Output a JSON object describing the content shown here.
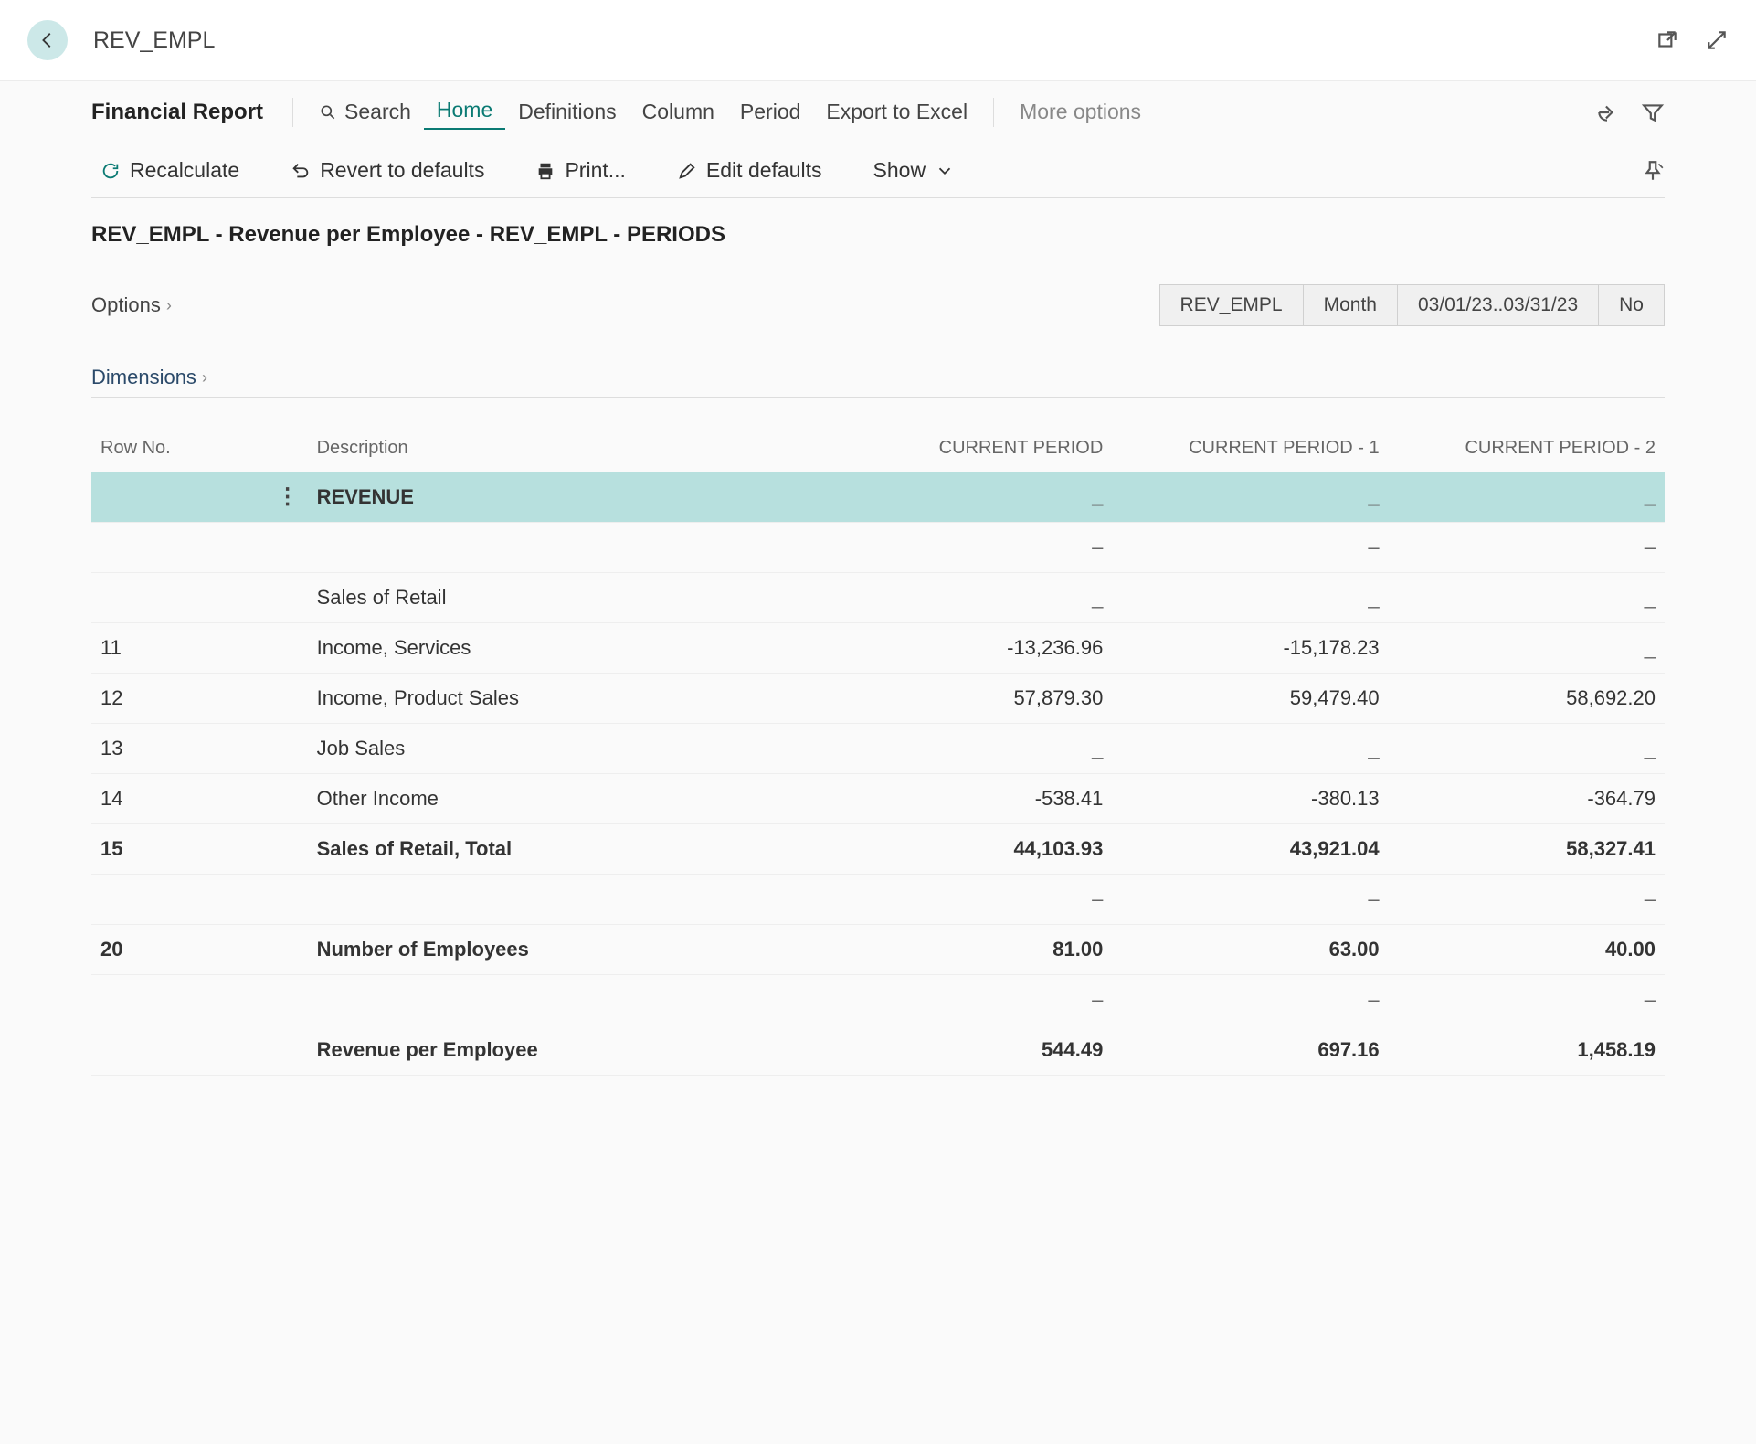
{
  "header": {
    "title": "REV_EMPL"
  },
  "cmdbar": {
    "report_label": "Financial Report",
    "search": "Search",
    "home": "Home",
    "definitions": "Definitions",
    "column": "Column",
    "period": "Period",
    "export": "Export to Excel",
    "more": "More options"
  },
  "toolbar": {
    "recalculate": "Recalculate",
    "revert": "Revert to defaults",
    "print": "Print...",
    "edit_defaults": "Edit defaults",
    "show": "Show"
  },
  "subtitle": "REV_EMPL - Revenue per Employee - REV_EMPL - PERIODS",
  "options_label": "Options",
  "dimensions_label": "Dimensions",
  "pills": {
    "code": "REV_EMPL",
    "period_type": "Month",
    "date_range": "03/01/23..03/31/23",
    "no": "No"
  },
  "table": {
    "headers": {
      "rowno": "Row No.",
      "description": "Description",
      "cp": "CURRENT PERIOD",
      "cp1": "CURRENT PERIOD - 1",
      "cp2": "CURRENT PERIOD - 2"
    },
    "rows": [
      {
        "no": "",
        "desc": "REVENUE",
        "c0": "_",
        "c1": "_",
        "c2": "_",
        "hl": true,
        "bold": true,
        "menu": true
      },
      {
        "no": "",
        "desc": "",
        "c0": "–",
        "c1": "–",
        "c2": "–"
      },
      {
        "no": "",
        "desc": "Sales of Retail",
        "c0": "_",
        "c1": "_",
        "c2": "_"
      },
      {
        "no": "11",
        "desc": "Income, Services",
        "c0": "-13,236.96",
        "c1": "-15,178.23",
        "c2": "_"
      },
      {
        "no": "12",
        "desc": "Income, Product Sales",
        "c0": "57,879.30",
        "c1": "59,479.40",
        "c2": "58,692.20"
      },
      {
        "no": "13",
        "desc": "Job Sales",
        "c0": "_",
        "c1": "_",
        "c2": "_"
      },
      {
        "no": "14",
        "desc": "Other Income",
        "c0": "-538.41",
        "c1": "-380.13",
        "c2": "-364.79"
      },
      {
        "no": "15",
        "desc": "Sales of Retail, Total",
        "c0": "44,103.93",
        "c1": "43,921.04",
        "c2": "58,327.41",
        "bold": true
      },
      {
        "no": "",
        "desc": "",
        "c0": "–",
        "c1": "–",
        "c2": "–"
      },
      {
        "no": "20",
        "desc": "Number of Employees",
        "c0": "81.00",
        "c1": "63.00",
        "c2": "40.00",
        "bold": true
      },
      {
        "no": "",
        "desc": "",
        "c0": "–",
        "c1": "–",
        "c2": "–"
      },
      {
        "no": "",
        "desc": "Revenue per Employee",
        "c0": "544.49",
        "c1": "697.16",
        "c2": "1,458.19",
        "bold": true
      }
    ]
  }
}
